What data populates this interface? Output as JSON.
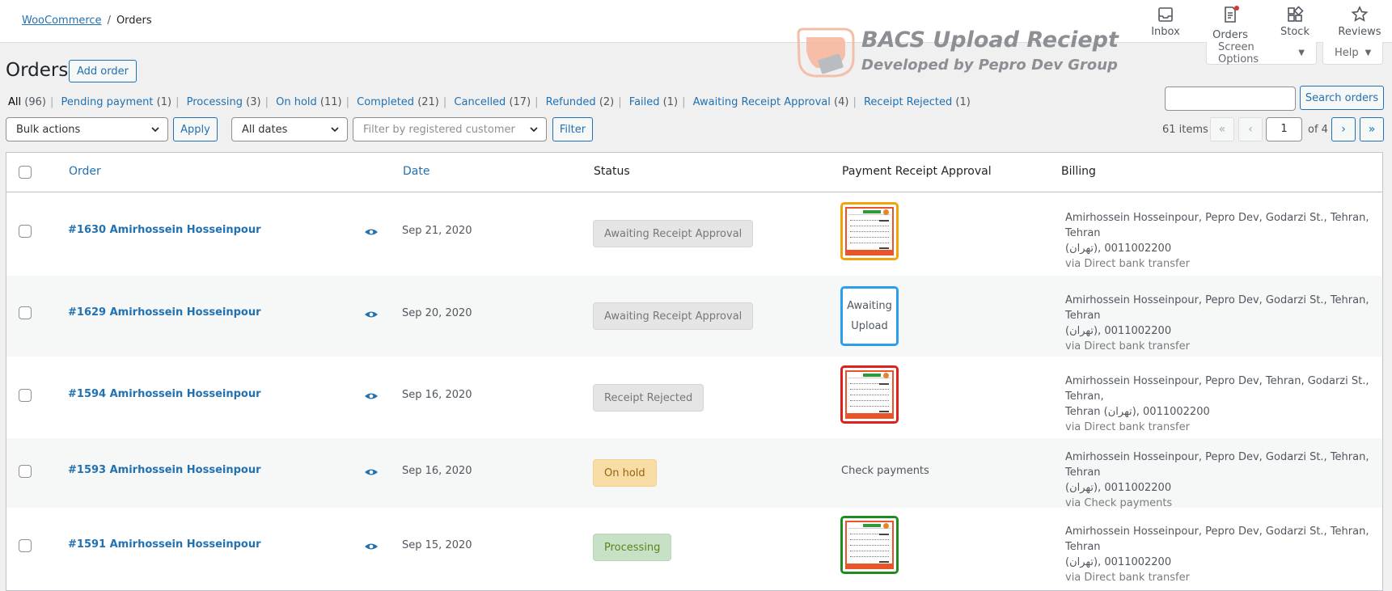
{
  "breadcrumb": {
    "root": "WooCommerce",
    "separator": "/",
    "current": "Orders"
  },
  "top_actions": [
    {
      "label": "Inbox",
      "icon": "inbox-icon"
    },
    {
      "label": "Orders",
      "icon": "orders-icon"
    },
    {
      "label": "Stock",
      "icon": "stock-icon"
    },
    {
      "label": "Reviews",
      "icon": "reviews-icon"
    }
  ],
  "promo": {
    "title": "BACS Upload Reciept",
    "subtitle": "Developed by Pepro Dev Group"
  },
  "screen_options": "Screen Options",
  "help": "Help",
  "page_title": "Orders",
  "add_order": "Add order",
  "status_filters": [
    {
      "label": "All",
      "count": "(96)",
      "current": true
    },
    {
      "label": "Pending payment",
      "count": "(1)"
    },
    {
      "label": "Processing",
      "count": "(3)"
    },
    {
      "label": "On hold",
      "count": "(11)"
    },
    {
      "label": "Completed",
      "count": "(21)"
    },
    {
      "label": "Cancelled",
      "count": "(17)"
    },
    {
      "label": "Refunded",
      "count": "(2)"
    },
    {
      "label": "Failed",
      "count": "(1)"
    },
    {
      "label": "Awaiting Receipt Approval",
      "count": "(4)"
    },
    {
      "label": "Receipt Rejected",
      "count": "(1)"
    }
  ],
  "search": {
    "value": "",
    "button": "Search orders"
  },
  "tablenav": {
    "bulk_actions": "Bulk actions",
    "apply": "Apply",
    "dates": "All dates",
    "customer_placeholder": "Filter by registered customer",
    "filter": "Filter",
    "items": "61 items",
    "first": "«",
    "prev": "‹",
    "page": "1",
    "of": "of 4",
    "next": "›",
    "last": "»"
  },
  "columns": {
    "order": "Order",
    "date": "Date",
    "status": "Status",
    "receipt": "Payment Receipt Approval",
    "billing": "Billing"
  },
  "orders": [
    {
      "order": "#1630 Amirhossein Hosseinpour",
      "date": "Sep 21, 2020",
      "status": "Awaiting Receipt Approval",
      "receipt_type": "image",
      "receipt_border": "#f0a30a",
      "billing_line1": "Amirhossein Hosseinpour, Pepro Dev, Godarzi St., Tehran, Tehran",
      "billing_line2": "(تهران), 0011002200",
      "via": "via Direct bank transfer"
    },
    {
      "order": "#1629 Amirhossein Hosseinpour",
      "date": "Sep 20, 2020",
      "status": "Awaiting Receipt Approval",
      "receipt_type": "text",
      "receipt_text_1": "Awaiting",
      "receipt_text_2": "Upload",
      "billing_line1": "Amirhossein Hosseinpour, Pepro Dev, Godarzi St., Tehran, Tehran",
      "billing_line2": "(تهران), 0011002200",
      "via": "via Direct bank transfer"
    },
    {
      "order": "#1594 Amirhossein Hosseinpour",
      "date": "Sep 16, 2020",
      "status": "Receipt Rejected",
      "receipt_type": "image",
      "receipt_border": "#e0201b",
      "billing_line1": "Amirhossein Hosseinpour, Pepro Dev, Tehran, Godarzi St., Tehran,",
      "billing_line2": "Tehran (تهران), 0011002200",
      "via": "via Direct bank transfer"
    },
    {
      "order": "#1593 Amirhossein Hosseinpour",
      "date": "Sep 16, 2020",
      "status": "On hold",
      "receipt_type": "plain",
      "receipt_plain": "Check payments",
      "billing_line1": "Amirhossein Hosseinpour, Pepro Dev, Godarzi St., Tehran, Tehran",
      "billing_line2": "(تهران), 0011002200",
      "via": "via Check payments"
    },
    {
      "order": "#1591 Amirhossein Hosseinpour",
      "date": "Sep 15, 2020",
      "status": "Processing",
      "receipt_type": "image",
      "receipt_border": "#1e8c1e",
      "billing_line1": "Amirhossein Hosseinpour, Pepro Dev, Godarzi St., Tehran, Tehran",
      "billing_line2": "(تهران), 0011002200",
      "via": "via Direct bank transfer"
    }
  ]
}
